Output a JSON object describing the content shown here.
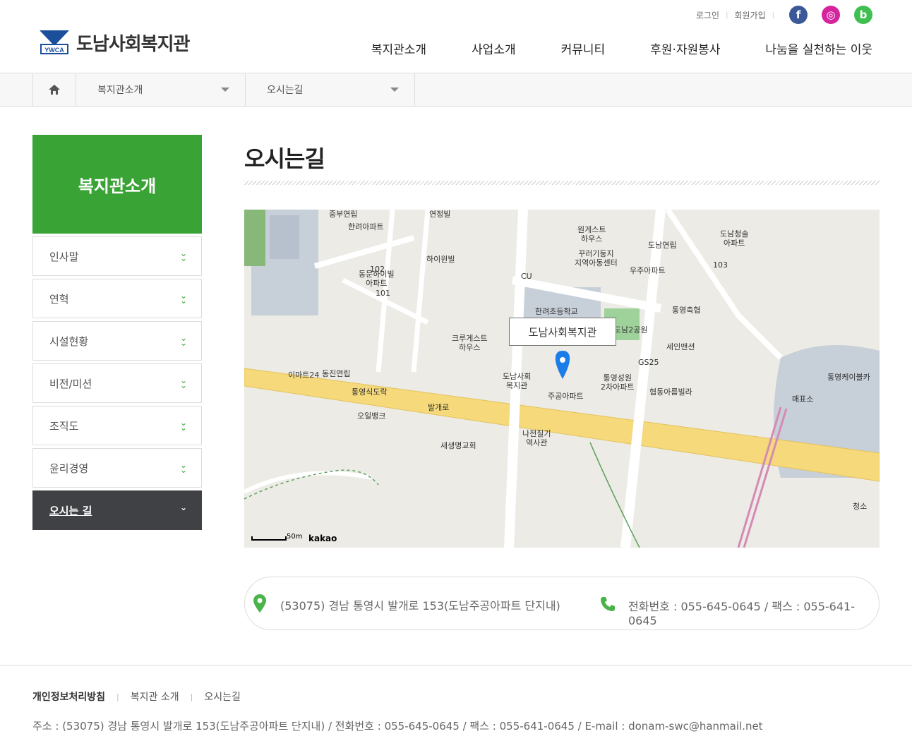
{
  "header": {
    "logo_mark": "YWCA",
    "logo_text": "도남사회복지관",
    "util": {
      "login": "로그인",
      "join": "회원가입"
    },
    "sns": [
      {
        "name": "facebook-icon",
        "glyph": "f",
        "color": "#3b5998"
      },
      {
        "name": "instagram-icon",
        "glyph": "◎",
        "color": "#d6249f"
      },
      {
        "name": "blog-icon",
        "glyph": "b",
        "color": "#3fbf4f"
      }
    ],
    "gnb": [
      "복지관소개",
      "사업소개",
      "커뮤니티",
      "후원·자원봉사",
      "나눔을 실천하는 이웃"
    ]
  },
  "breadcrumb": {
    "level1": "복지관소개",
    "level2": "오시는길"
  },
  "sidebar": {
    "title": "복지관소개",
    "items": [
      {
        "label": "인사말"
      },
      {
        "label": "연혁"
      },
      {
        "label": "시설현황"
      },
      {
        "label": "비전/미션"
      },
      {
        "label": "조직도"
      },
      {
        "label": "윤리경영"
      },
      {
        "label": "오시는 길",
        "active": true
      }
    ]
  },
  "main": {
    "title": "오시는길",
    "map": {
      "popup": "도남사회복지관",
      "scale": "50m",
      "provider": "kakao",
      "labels": [
        "중부연립",
        "연정빌",
        "한려아파트",
        "하이원빌",
        "동문하이빌\n아파트",
        "102",
        "101",
        "원게스트\n하우스",
        "도남연립",
        "도남청솔\n아파트",
        "103",
        "꾸러기둥지\n지역아동센터",
        "우주아파트",
        "CU",
        "한려초등학교",
        "통영축협",
        "도남2공원",
        "세인맨션",
        "크루게스트\n하우스",
        "GS25",
        "이마트24",
        "동진연립",
        "통영식도락",
        "오일뱅크",
        "도남사회\n복지관",
        "주공아파트",
        "통영성원\n2차아파트",
        "협동아름빌라",
        "통영케이블카",
        "매표소",
        "새생명교회",
        "나전칠기\n역사관",
        "발개로",
        "청소"
      ]
    },
    "address": "(53075) 경남 통영시 발개로 153(도남주공아파트 단지내)",
    "contact": "전화번호 : 055-645-0645 / 팩스 : 055-641-0645"
  },
  "footer": {
    "links": [
      "개인정보처리방침",
      "복지관 소개",
      "오시는길"
    ],
    "address_line": "주소 : (53075) 경남 통영시 발개로 153(도남주공아파트 단지내)  /  전화번호 : 055-645-0645  /  팩스 : 055-641-0645  /  E-mail : donam-swc@hanmail.net"
  },
  "colors": {
    "brand_green": "#3aa335",
    "active_dark": "#3f4144",
    "road_yellow": "#f5d97a"
  }
}
